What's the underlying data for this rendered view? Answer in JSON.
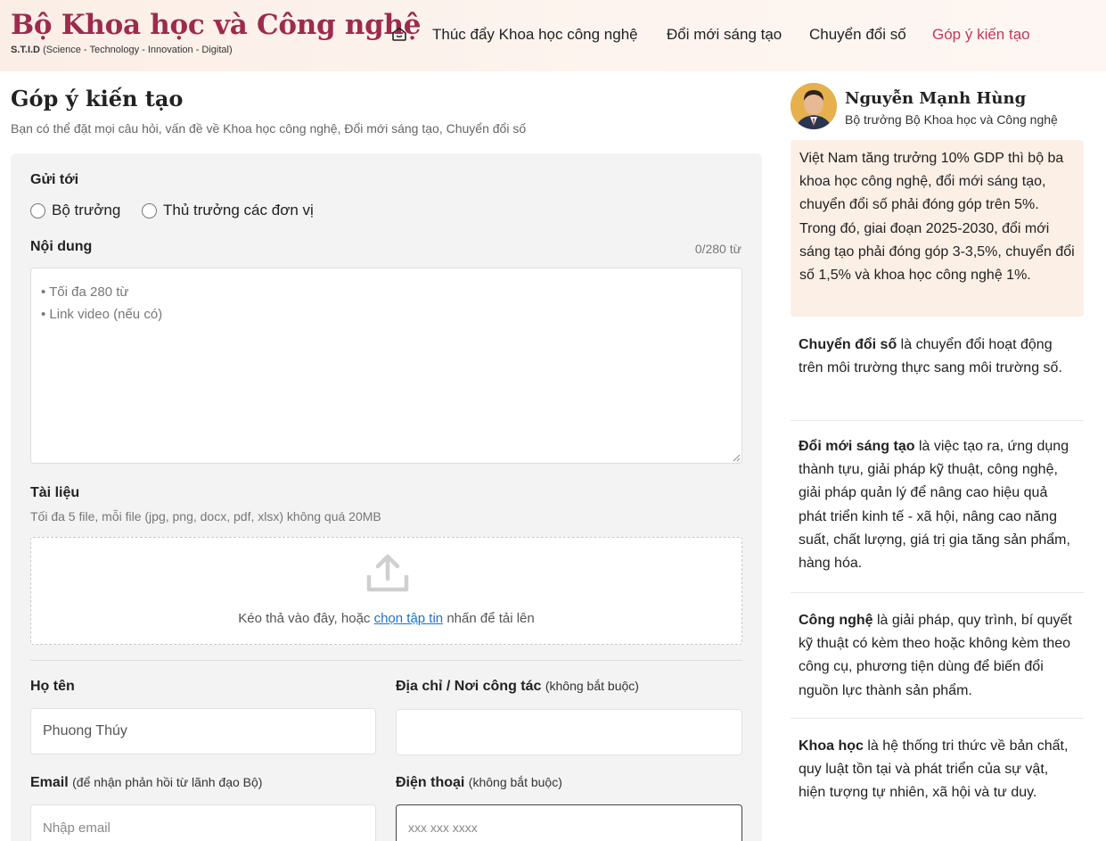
{
  "header": {
    "brand_title": "Bộ Khoa học và Công nghệ",
    "brand_abbr": "S.T.I.D",
    "brand_tagline": "(Science - Technology - Innovation - Digital)",
    "nav": [
      {
        "label": "Thúc đẩy Khoa học công nghệ"
      },
      {
        "label": "Đổi mới sáng tạo"
      },
      {
        "label": "Chuyển đổi số"
      },
      {
        "label": "Góp ý kiến tạo",
        "active": true
      }
    ],
    "home_icon": "home-icon",
    "brand_color": "#9c2b4e",
    "active_color": "#c2375e"
  },
  "page": {
    "title": "Góp ý kiến tạo",
    "description": "Bạn có thể đặt mọi câu hỏi, vấn đề về Khoa học công nghệ, Đổi mới sáng tạo, Chuyển đổi số"
  },
  "form": {
    "send_to_label": "Gửi tới",
    "recipients": [
      "Bộ trưởng",
      "Thủ trưởng các đơn vị"
    ],
    "content_label": "Nội dung",
    "content_counter": "0/280 từ",
    "content_placeholder": "• Tối đa 280 từ\n• Link video (nếu có)",
    "documents_label": "Tài liệu",
    "documents_hint": "Tối đa 5 file, mỗi file (jpg, png, docx, pdf, xlsx) không quá 20MB",
    "upload_icon": "upload-icon",
    "drop_text_before": "Kéo thả vào đây, hoặc ",
    "drop_link": "chọn tập tin",
    "drop_text_after": " nhấn để tải lên",
    "name_label": "Họ tên",
    "name_value": "Phuong Thúy",
    "address_label": "Địa chỉ / Nơi công tác",
    "address_optional": "(không bắt buộc)",
    "address_value": "",
    "email_label": "Email",
    "email_note": "(để nhận phản hồi từ lãnh đạo Bộ)",
    "email_placeholder": "Nhập email",
    "phone_label": "Điện thoại",
    "phone_optional": "(không bắt buộc)",
    "phone_placeholder": "xxx xxx xxxx"
  },
  "sidebar": {
    "minister_name": "Nguyễn Mạnh Hùng",
    "minister_role": "Bộ trưởng Bộ Khoa học và Công nghệ",
    "quote": "Việt Nam tăng trưởng 10% GDP thì bộ ba khoa học công nghệ, đổi mới sáng tạo, chuyển đổi số phải đóng góp trên 5%. Trong đó, giai đoạn 2025-2030, đổi mới sáng tạo phải đóng góp 3-3,5%, chuyển đổi số 1,5% và khoa học công nghệ 1%.",
    "quote_bg": "#fcefe6",
    "definitions": [
      {
        "term": "Chuyển đổi số",
        "text": " là chuyển đổi hoạt động trên môi trường thực sang môi trường số."
      },
      {
        "term": "Đổi mới sáng tạo",
        "text": " là việc tạo ra, ứng dụng thành tựu, giải pháp kỹ thuật, công nghệ, giải pháp quản lý để nâng cao hiệu quả phát triển kinh tế - xã hội, nâng cao năng suất, chất lượng, giá trị gia tăng sản phẩm, hàng hóa."
      },
      {
        "term": "Công nghệ",
        "text": " là giải pháp, quy trình, bí quyết kỹ thuật có kèm theo hoặc không kèm theo công cụ, phương tiện dùng để biến đổi nguồn lực thành sản phẩm."
      },
      {
        "term": "Khoa học",
        "text": " là hệ thống tri thức về bản chất, quy luật tồn tại và phát triển của sự vật, hiện tượng tự nhiên, xã hội và tư duy."
      }
    ]
  }
}
